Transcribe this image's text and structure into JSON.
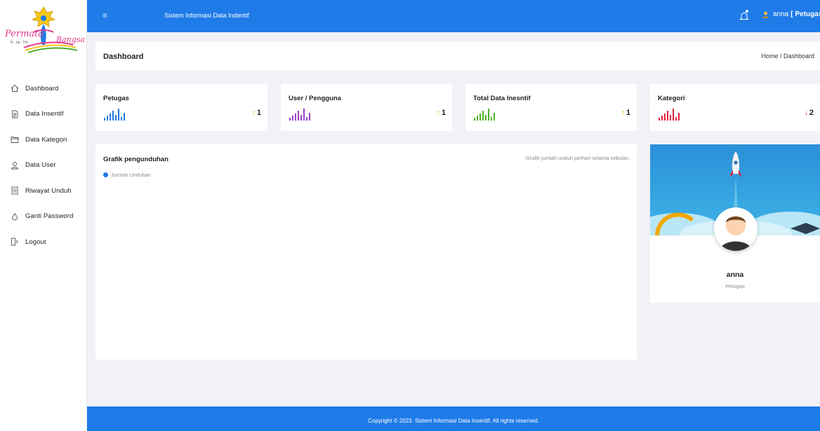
{
  "logo": {
    "text": "Permata Bangsa",
    "tagline": "TK - KB - TPA"
  },
  "sidebar": {
    "items": [
      {
        "label": "Dashboard",
        "icon": "home-icon"
      },
      {
        "label": "Data Insentif",
        "icon": "document-icon"
      },
      {
        "label": "Data Kategori",
        "icon": "folder-icon"
      },
      {
        "label": "Data User",
        "icon": "user-icon"
      },
      {
        "label": "Riwayat Unduh",
        "icon": "history-icon"
      },
      {
        "label": "Ganti Password",
        "icon": "key-icon"
      },
      {
        "label": "Logout",
        "icon": "logout-icon"
      }
    ]
  },
  "topbar": {
    "menu_icon": "≡",
    "title": "Sistem Informasi Data Indentif",
    "user_name": "anna",
    "user_role": "[ Petugas ]",
    "caret": "⌄"
  },
  "page": {
    "title": "Dashboard",
    "breadcrumb": "Home / Dashboard"
  },
  "stats": [
    {
      "title": "Petugas",
      "value": "1",
      "trend": "up",
      "arrow": "↑",
      "color": "#1f7be8"
    },
    {
      "title": "User / Pengguna",
      "value": "1",
      "trend": "up",
      "arrow": "↑",
      "color": "#9b3fc7"
    },
    {
      "title": "Total Data Inesntif",
      "value": "1",
      "trend": "up",
      "arrow": "↑",
      "color": "#4caf2d"
    },
    {
      "title": "Kategori",
      "value": "2",
      "trend": "down",
      "arrow": "↓",
      "color": "#e0243c"
    }
  ],
  "chart": {
    "title": "Grafik pengunduhan",
    "subtitle": "Grafik jumlah unduh perhari selama sebulan",
    "legend": "Jumlah Unduhan"
  },
  "profile": {
    "name": "anna",
    "role": "Petugas"
  },
  "footer": {
    "text": "Copyright © 2023. Sistem Informasi Data Insentif. All rights reserved."
  },
  "colors": {
    "primary": "#1f7be8",
    "background": "#f1f2f7",
    "up_arrow": "#f0a800",
    "down_arrow": "#e0243c"
  }
}
